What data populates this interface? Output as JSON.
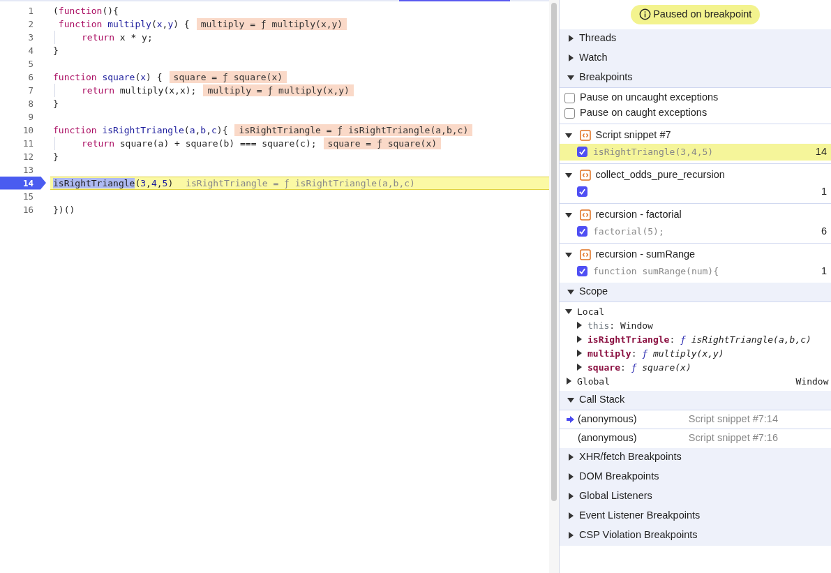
{
  "code_lines": [
    {
      "number": "1",
      "tokens": [
        {
          "text": "(",
          "kind": "plain"
        },
        {
          "text": "function",
          "kind": "keyword"
        },
        {
          "text": "(){",
          "kind": "plain"
        }
      ]
    },
    {
      "number": "2",
      "tokens": [
        {
          "text": " function",
          "kind": "keyword"
        },
        {
          "text": " multiply",
          "kind": "def"
        },
        {
          "text": "(",
          "kind": "plain"
        },
        {
          "text": "x",
          "kind": "param"
        },
        {
          "text": ",",
          "kind": "plain"
        },
        {
          "text": "y",
          "kind": "param"
        },
        {
          "text": ") {",
          "kind": "plain"
        }
      ],
      "inline_value": "multiply = ƒ multiply(x,y)"
    },
    {
      "number": "3",
      "indent": true,
      "tokens": [
        {
          "text": "return",
          "kind": "keyword"
        },
        {
          "text": " x * y;",
          "kind": "plain"
        }
      ]
    },
    {
      "number": "4",
      "tokens": [
        {
          "text": "}",
          "kind": "plain"
        }
      ]
    },
    {
      "number": "5"
    },
    {
      "number": "6",
      "tokens": [
        {
          "text": "function",
          "kind": "keyword"
        },
        {
          "text": " square",
          "kind": "def"
        },
        {
          "text": "(",
          "kind": "plain"
        },
        {
          "text": "x",
          "kind": "param"
        },
        {
          "text": ") {",
          "kind": "plain"
        }
      ],
      "inline_value": "square = ƒ square(x)"
    },
    {
      "number": "7",
      "indent": true,
      "tokens": [
        {
          "text": "return",
          "kind": "keyword"
        },
        {
          "text": " multiply(x,x);",
          "kind": "plain"
        }
      ],
      "inline_value": "multiply = ƒ multiply(x,y)"
    },
    {
      "number": "8",
      "tokens": [
        {
          "text": "}",
          "kind": "plain"
        }
      ]
    },
    {
      "number": "9"
    },
    {
      "number": "10",
      "tokens": [
        {
          "text": "function",
          "kind": "keyword"
        },
        {
          "text": " isRightTriangle",
          "kind": "def"
        },
        {
          "text": "(",
          "kind": "plain"
        },
        {
          "text": "a",
          "kind": "param"
        },
        {
          "text": ",",
          "kind": "plain"
        },
        {
          "text": "b",
          "kind": "param"
        },
        {
          "text": ",",
          "kind": "plain"
        },
        {
          "text": "c",
          "kind": "param"
        },
        {
          "text": "){",
          "kind": "plain"
        }
      ],
      "inline_value": "isRightTriangle = ƒ isRightTriangle(a,b,c)"
    },
    {
      "number": "11",
      "indent": true,
      "tokens": [
        {
          "text": "return",
          "kind": "keyword"
        },
        {
          "text": " square(a) + square(b) === square(c);",
          "kind": "plain"
        }
      ],
      "inline_value": "square = ƒ square(x)"
    },
    {
      "number": "12",
      "tokens": [
        {
          "text": "}",
          "kind": "plain"
        }
      ]
    },
    {
      "number": "13"
    },
    {
      "number": "14",
      "current": true,
      "breakpoint": true,
      "tokens": [
        {
          "text": "isRightTriangle",
          "kind": "selection"
        },
        {
          "text": "(",
          "kind": "plain"
        },
        {
          "text": "3",
          "kind": "number"
        },
        {
          "text": ",",
          "kind": "plain"
        },
        {
          "text": "4",
          "kind": "number"
        },
        {
          "text": ",",
          "kind": "plain"
        },
        {
          "text": "5",
          "kind": "number"
        },
        {
          "text": ")",
          "kind": "plain"
        }
      ],
      "inline_value": "isRightTriangle = ƒ isRightTriangle(a,b,c)"
    },
    {
      "number": "15"
    },
    {
      "number": "16",
      "tokens": [
        {
          "text": "})()",
          "kind": "plain"
        }
      ]
    }
  ],
  "paused_banner": "Paused on breakpoint",
  "sections": [
    {
      "title": "Threads",
      "expanded": false,
      "kind": "plain"
    },
    {
      "title": "Watch",
      "expanded": false,
      "kind": "plain"
    },
    {
      "title": "Breakpoints",
      "expanded": true,
      "kind": "breakpoints",
      "options": [
        {
          "label": "Pause on uncaught exceptions",
          "checked": false
        },
        {
          "label": "Pause on caught exceptions",
          "checked": false
        }
      ],
      "files": [
        {
          "name": "Script snippet #7",
          "expanded": true,
          "items": [
            {
              "code": "isRightTriangle(3,4,5)",
              "line": "14",
              "checked": true,
              "selected": true
            }
          ]
        },
        {
          "name": "collect_odds_pure_recursion",
          "expanded": true,
          "items": [
            {
              "line": "1",
              "checked": true,
              "selected": false
            }
          ]
        },
        {
          "name": "recursion - factorial",
          "expanded": true,
          "items": [
            {
              "code": "factorial(5);",
              "line": "6",
              "checked": true,
              "selected": false
            }
          ]
        },
        {
          "name": "recursion - sumRange",
          "expanded": true,
          "items": [
            {
              "code": "function sumRange(num){",
              "line": "1",
              "checked": true,
              "selected": false
            }
          ]
        }
      ]
    },
    {
      "title": "Scope",
      "expanded": true,
      "kind": "scope",
      "groups": [
        {
          "name": "Local",
          "expanded": true,
          "children": [
            {
              "name": "this",
              "separator": ":",
              "kind": "this",
              "expanded": false,
              "value": "Window"
            },
            {
              "name": "isRightTriangle",
              "separator": ":",
              "kind": "function",
              "expanded": false,
              "prefix": "ƒ",
              "value": "isRightTriangle(a,b,c)"
            },
            {
              "name": "multiply",
              "separator": ":",
              "kind": "function",
              "expanded": false,
              "prefix": "ƒ",
              "value": "multiply(x,y)"
            },
            {
              "name": "square",
              "separator": ":",
              "kind": "function",
              "expanded": false,
              "prefix": "ƒ",
              "value": "square(x)"
            }
          ]
        },
        {
          "name": "Global",
          "expanded": false,
          "value": "Window"
        }
      ]
    },
    {
      "title": "Call Stack",
      "expanded": true,
      "kind": "call_stack",
      "frames": [
        {
          "name": "(anonymous)",
          "location": "Script snippet #7:14",
          "selected": true
        },
        {
          "name": "(anonymous)",
          "location": "Script snippet #7:16",
          "selected": false
        }
      ]
    },
    {
      "title": "XHR/fetch Breakpoints",
      "expanded": false,
      "kind": "plain"
    },
    {
      "title": "DOM Breakpoints",
      "expanded": false,
      "kind": "plain"
    },
    {
      "title": "Global Listeners",
      "expanded": false,
      "kind": "plain"
    },
    {
      "title": "Event Listener Breakpoints",
      "expanded": false,
      "kind": "plain"
    },
    {
      "title": "CSP Violation Breakpoints",
      "expanded": false,
      "kind": "plain"
    }
  ]
}
